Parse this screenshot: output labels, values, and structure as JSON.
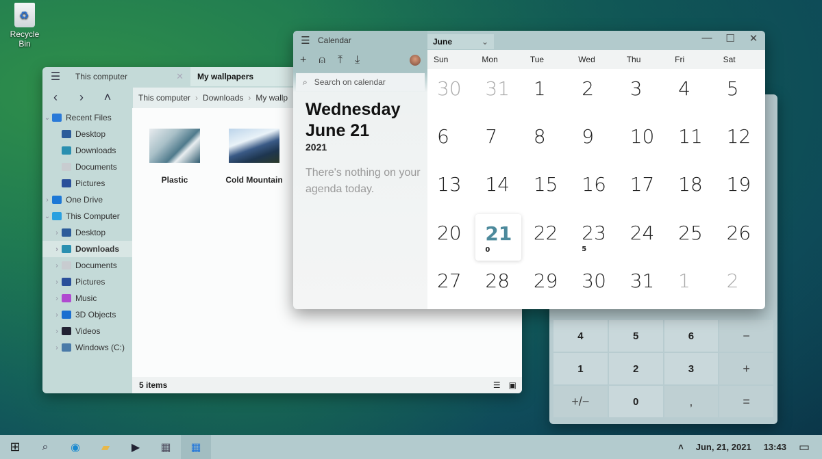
{
  "desktop": {
    "recycle_bin_label": "Recycle Bin"
  },
  "explorer": {
    "tabs": [
      {
        "label": "This computer",
        "active": false
      },
      {
        "label": "My wallpapers",
        "active": true
      }
    ],
    "breadcrumb": [
      "This computer",
      "Downloads",
      "My wallp"
    ],
    "sidebar": [
      {
        "label": "Recent Files",
        "level": 0,
        "chevron": "v",
        "icon": "star-icon",
        "color": "#2a7ad8"
      },
      {
        "label": "Desktop",
        "level": 1,
        "chevron": "",
        "icon": "desktop-icon",
        "color": "#2c5b9a"
      },
      {
        "label": "Downloads",
        "level": 1,
        "chevron": "",
        "icon": "download-icon",
        "color": "#2a8fb0"
      },
      {
        "label": "Documents",
        "level": 1,
        "chevron": "",
        "icon": "document-icon",
        "color": "#c8ccd0"
      },
      {
        "label": "Pictures",
        "level": 1,
        "chevron": "",
        "icon": "pictures-icon",
        "color": "#2a4f9a"
      },
      {
        "label": "One Drive",
        "level": 0,
        "chevron": ">",
        "icon": "cloud-icon",
        "color": "#1d78d6"
      },
      {
        "label": "This Computer",
        "level": 0,
        "chevron": "v",
        "icon": "computer-icon",
        "color": "#2aa0e0"
      },
      {
        "label": "Desktop",
        "level": 1,
        "chevron": ">",
        "icon": "desktop-icon",
        "color": "#2c5b9a"
      },
      {
        "label": "Downloads",
        "level": 1,
        "chevron": ">",
        "icon": "download-icon",
        "color": "#2a8fb0",
        "selected": true
      },
      {
        "label": "Documents",
        "level": 1,
        "chevron": ">",
        "icon": "document-icon",
        "color": "#c8ccd0"
      },
      {
        "label": "Pictures",
        "level": 1,
        "chevron": ">",
        "icon": "pictures-icon",
        "color": "#2a4f9a"
      },
      {
        "label": "Music",
        "level": 1,
        "chevron": ">",
        "icon": "music-icon",
        "color": "#b04ad0"
      },
      {
        "label": "3D Objects",
        "level": 1,
        "chevron": ">",
        "icon": "cube-icon",
        "color": "#1a6fd0"
      },
      {
        "label": "Videos",
        "level": 1,
        "chevron": ">",
        "icon": "video-icon",
        "color": "#223"
      },
      {
        "label": "Windows (C:)",
        "level": 1,
        "chevron": ">",
        "icon": "drive-icon",
        "color": "#4a7aa8"
      }
    ],
    "files": [
      {
        "name": "Plastic"
      },
      {
        "name": "Cold Mountain"
      }
    ],
    "status": "5 items"
  },
  "calendar": {
    "app_title": "Calendar",
    "search_placeholder": "Search on calendar",
    "weekday": "Wednesday",
    "date": "June 21",
    "year": "2021",
    "agenda": "There's nothing on your agenda today.",
    "month": "June",
    "weekdays": [
      "Sun",
      "Mon",
      "Tue",
      "Wed",
      "Thu",
      "Fri",
      "Sat"
    ],
    "days": [
      {
        "d": "30",
        "dim": true
      },
      {
        "d": "31",
        "dim": true
      },
      {
        "d": "1"
      },
      {
        "d": "2"
      },
      {
        "d": "3"
      },
      {
        "d": "4"
      },
      {
        "d": "5"
      },
      {
        "d": "6"
      },
      {
        "d": "7"
      },
      {
        "d": "8"
      },
      {
        "d": "9"
      },
      {
        "d": "10"
      },
      {
        "d": "11"
      },
      {
        "d": "12"
      },
      {
        "d": "13"
      },
      {
        "d": "14"
      },
      {
        "d": "15"
      },
      {
        "d": "16"
      },
      {
        "d": "17"
      },
      {
        "d": "18"
      },
      {
        "d": "19"
      },
      {
        "d": "20"
      },
      {
        "d": "21",
        "today": true,
        "count": "0"
      },
      {
        "d": "22"
      },
      {
        "d": "23",
        "count": "5"
      },
      {
        "d": "24"
      },
      {
        "d": "25"
      },
      {
        "d": "26"
      },
      {
        "d": "27"
      },
      {
        "d": "28"
      },
      {
        "d": "29"
      },
      {
        "d": "30"
      },
      {
        "d": "31"
      },
      {
        "d": "1",
        "dim": true
      },
      {
        "d": "2",
        "dim": true
      }
    ]
  },
  "calculator": {
    "keys": [
      {
        "k": "4"
      },
      {
        "k": "5"
      },
      {
        "k": "6"
      },
      {
        "k": "−",
        "op": true
      },
      {
        "k": "1"
      },
      {
        "k": "2"
      },
      {
        "k": "3"
      },
      {
        "k": "+",
        "op": true
      },
      {
        "k": "+/−",
        "op": true
      },
      {
        "k": "0"
      },
      {
        "k": ",",
        "op": true
      },
      {
        "k": "=",
        "op": true
      }
    ]
  },
  "taskbar": {
    "date": "Jun, 21, 2021",
    "time": "13:43"
  }
}
